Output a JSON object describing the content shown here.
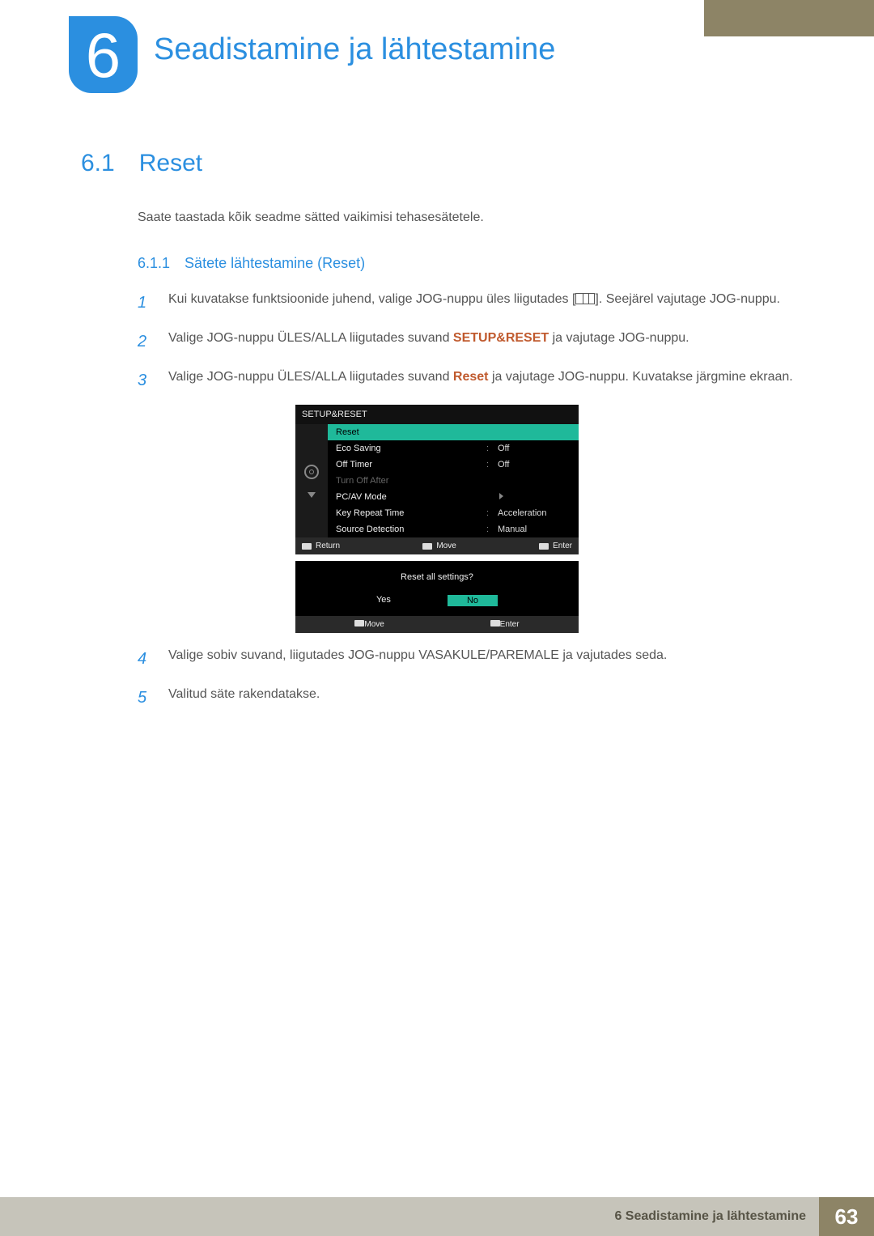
{
  "chapter": {
    "number": "6",
    "title": "Seadistamine ja lähtestamine"
  },
  "section": {
    "number": "6.1",
    "title": "Reset",
    "intro": "Saate taastada kõik seadme sätted vaikimisi tehasesätetele."
  },
  "subsection": {
    "number": "6.1.1",
    "title": "Sätete lähtestamine (Reset)"
  },
  "steps": {
    "s1": {
      "n": "1",
      "t1": "Kui kuvatakse funktsioonide juhend, valige JOG-nuppu üles liigutades [",
      "t2": "]. Seejärel vajutage JOG-nuppu."
    },
    "s2": {
      "n": "2",
      "t1": "Valige JOG-nuppu ÜLES/ALLA liigutades suvand ",
      "hl": "SETUP&RESET",
      "t2": " ja vajutage JOG-nuppu."
    },
    "s3": {
      "n": "3",
      "t1": "Valige JOG-nuppu ÜLES/ALLA liigutades suvand ",
      "hl": "Reset",
      "t2": " ja vajutage JOG-nuppu. Kuvatakse järgmine ekraan."
    },
    "s4": {
      "n": "4",
      "t": "Valige sobiv suvand, liigutades JOG-nuppu VASAKULE/PAREMALE ja vajutades seda."
    },
    "s5": {
      "n": "5",
      "t": "Valitud säte rakendatakse."
    }
  },
  "osd": {
    "header": "SETUP&RESET",
    "rows": [
      {
        "label": "Reset",
        "value": "",
        "sel": true
      },
      {
        "label": "Eco Saving",
        "value": "Off"
      },
      {
        "label": "Off Timer",
        "value": "Off"
      },
      {
        "label": "Turn Off After",
        "value": "",
        "dim": true
      },
      {
        "label": "PC/AV Mode",
        "value": "",
        "arrow": true
      },
      {
        "label": "Key Repeat Time",
        "value": "Acceleration"
      },
      {
        "label": "Source Detection",
        "value": "Manual"
      }
    ],
    "foot": {
      "return": "Return",
      "move": "Move",
      "enter": "Enter"
    }
  },
  "confirm": {
    "q": "Reset all settings?",
    "yes": "Yes",
    "no": "No",
    "move": "Move",
    "enter": "Enter"
  },
  "footer": {
    "text": "6 Seadistamine ja lähtestamine",
    "page": "63"
  }
}
